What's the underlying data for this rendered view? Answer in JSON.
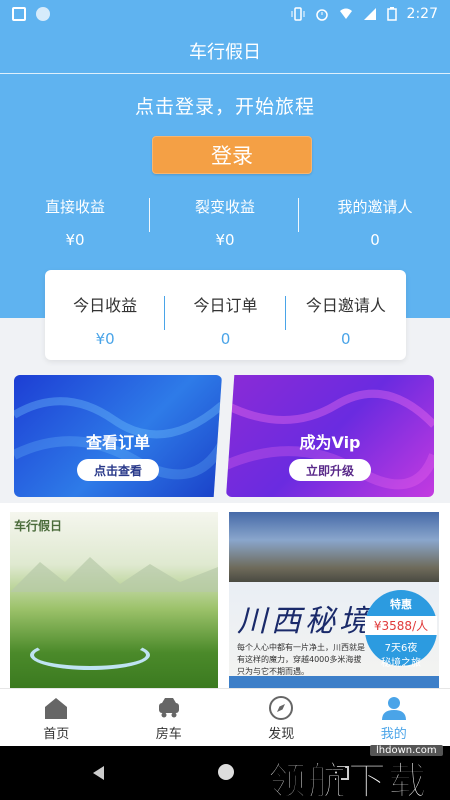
{
  "statusbar": {
    "time": "2:27"
  },
  "header": {
    "title": "车行假日",
    "subtitle": "点击登录，开始旅程",
    "login_label": "登录"
  },
  "stats": [
    {
      "label": "直接收益",
      "value": "¥0"
    },
    {
      "label": "裂变收益",
      "value": "¥0"
    },
    {
      "label": "我的邀请人",
      "value": "0"
    }
  ],
  "today": [
    {
      "label": "今日收益",
      "value": "¥0"
    },
    {
      "label": "今日订单",
      "value": "0"
    },
    {
      "label": "今日邀请人",
      "value": "0"
    }
  ],
  "promos": {
    "orders": {
      "title": "查看订单",
      "button": "点击查看"
    },
    "vip": {
      "title": "成为Vip",
      "button": "立即升级"
    }
  },
  "tiles": {
    "tile1": {
      "logo": "车行假日"
    },
    "tile2": {
      "title": "川西秘境",
      "badge_top": "特惠",
      "price": "¥3588/人",
      "duration": "7天6夜",
      "name": "秘境之旅",
      "desc": "每个人心中都有一片净土，川西就是有这样的魔力，穿越4000多米海拔只为与它不期而遇。"
    }
  },
  "tabbar": [
    {
      "label": "首页",
      "icon": "home-icon",
      "active": false
    },
    {
      "label": "房车",
      "icon": "car-icon",
      "active": false
    },
    {
      "label": "发现",
      "icon": "compass-icon",
      "active": false
    },
    {
      "label": "我的",
      "icon": "user-icon",
      "active": true
    }
  ],
  "watermark": {
    "url": "lhdown.com",
    "brand": "领航下载"
  },
  "colors": {
    "primary": "#5fb3f0",
    "accent": "#f4a045",
    "active_tab": "#4aa4e8"
  }
}
